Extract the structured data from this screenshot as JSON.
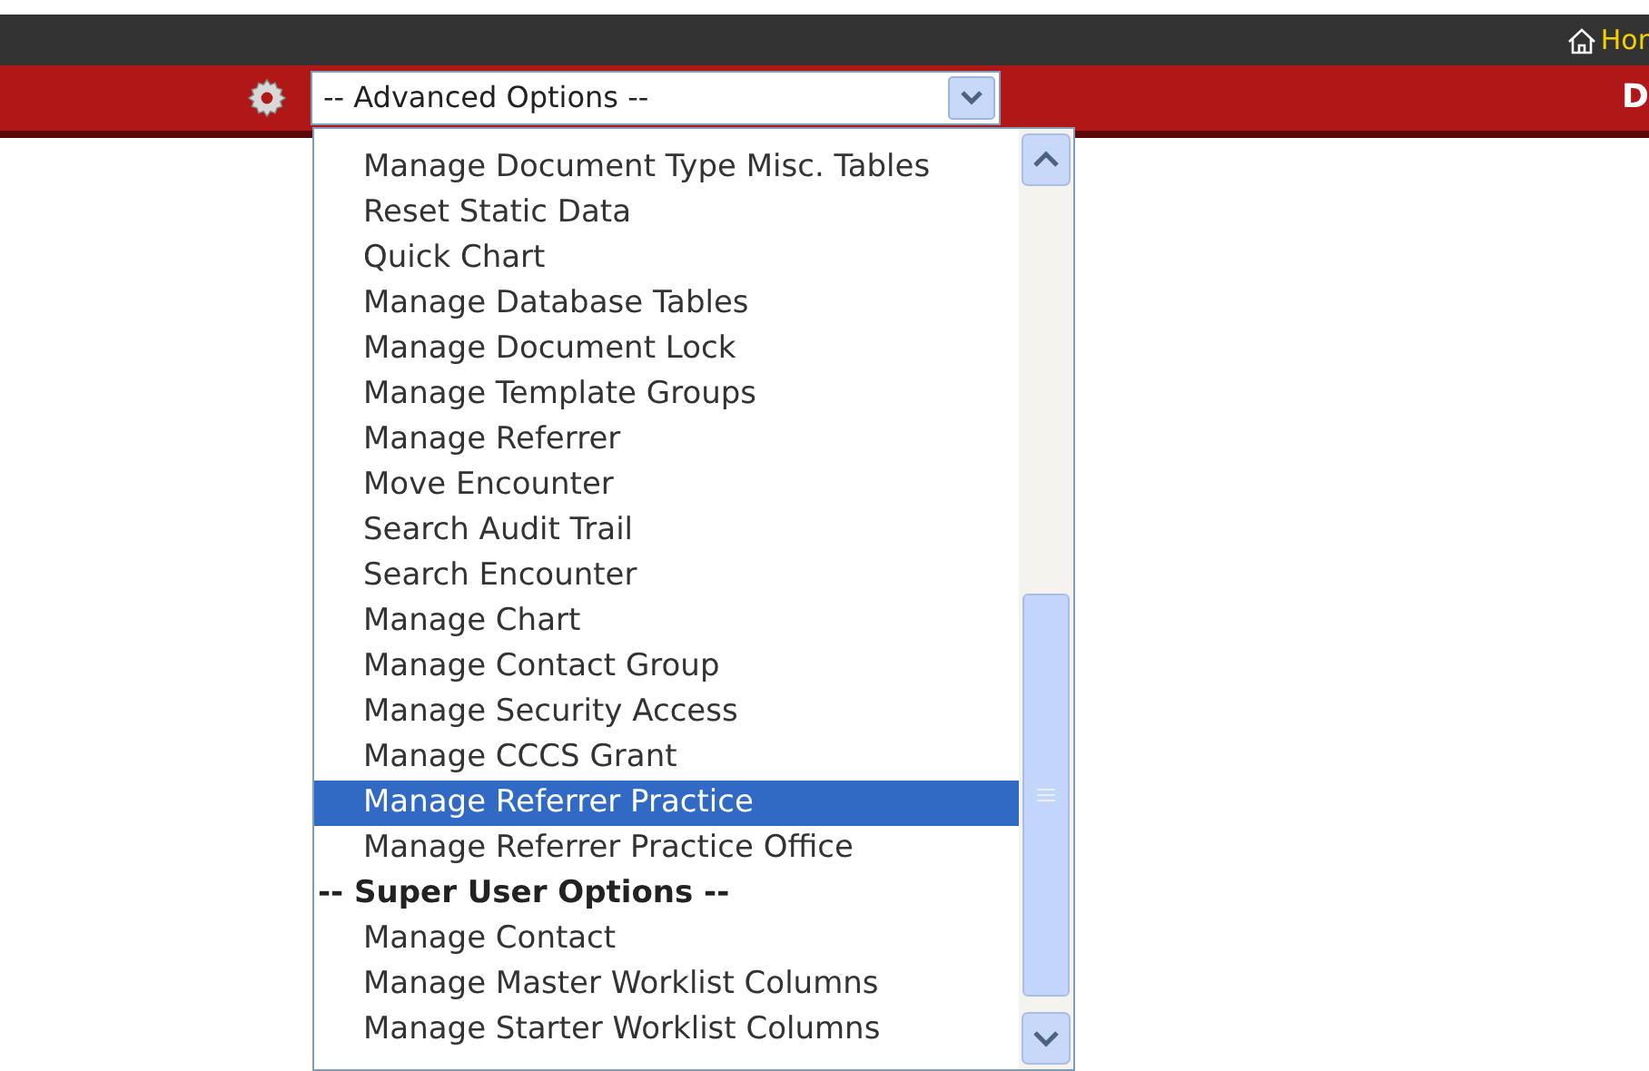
{
  "top_bar": {
    "home_link": "Hor"
  },
  "toolbar": {
    "select": {
      "value": "-- Advanced Options --"
    },
    "right_text": "D"
  },
  "dropdown": {
    "items": [
      {
        "kind": "option",
        "label": "Manage Document Type Misc. Tables",
        "selected": false
      },
      {
        "kind": "option",
        "label": "Reset Static Data",
        "selected": false
      },
      {
        "kind": "option",
        "label": "Quick Chart",
        "selected": false
      },
      {
        "kind": "option",
        "label": "Manage Database Tables",
        "selected": false
      },
      {
        "kind": "option",
        "label": "Manage Document Lock",
        "selected": false
      },
      {
        "kind": "option",
        "label": "Manage Template Groups",
        "selected": false
      },
      {
        "kind": "option",
        "label": "Manage Referrer",
        "selected": false
      },
      {
        "kind": "option",
        "label": "Move Encounter",
        "selected": false
      },
      {
        "kind": "option",
        "label": "Search Audit Trail",
        "selected": false
      },
      {
        "kind": "option",
        "label": "Search Encounter",
        "selected": false
      },
      {
        "kind": "option",
        "label": "Manage Chart",
        "selected": false
      },
      {
        "kind": "option",
        "label": "Manage Contact Group",
        "selected": false
      },
      {
        "kind": "option",
        "label": "Manage Security Access",
        "selected": false
      },
      {
        "kind": "option",
        "label": "Manage CCCS Grant",
        "selected": false
      },
      {
        "kind": "option",
        "label": "Manage Referrer Practice",
        "selected": true
      },
      {
        "kind": "option",
        "label": "Manage Referrer Practice Office",
        "selected": false
      },
      {
        "kind": "group",
        "label": "-- Super User Options --"
      },
      {
        "kind": "option",
        "label": "Manage Contact",
        "selected": false
      },
      {
        "kind": "option",
        "label": "Manage Master Worklist Columns",
        "selected": false
      },
      {
        "kind": "option",
        "label": "Manage Starter Worklist Columns",
        "selected": false
      }
    ]
  }
}
